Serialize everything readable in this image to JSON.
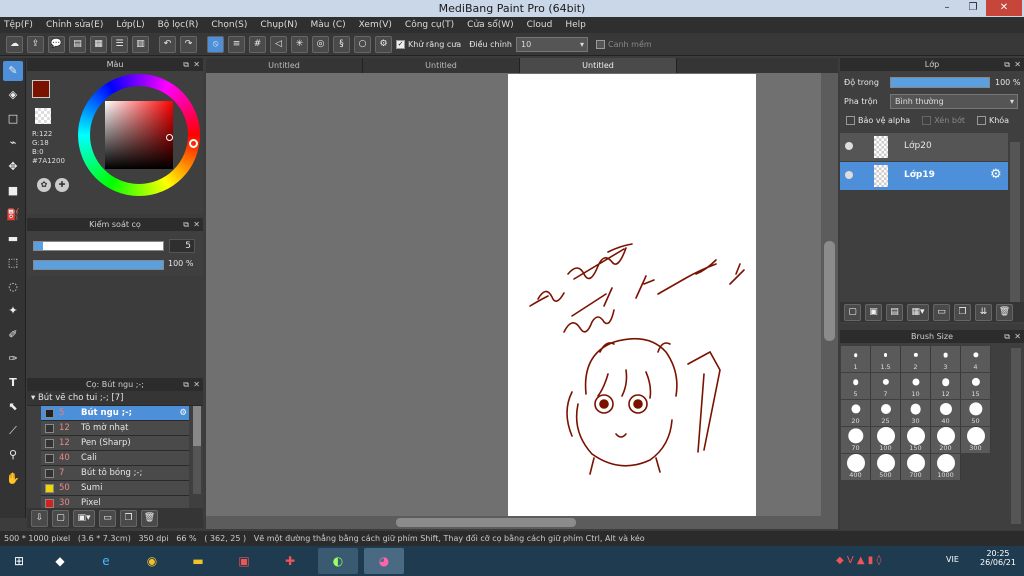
{
  "window": {
    "title": "MediBang Paint Pro (64bit)",
    "minimize": "–",
    "maximize": "❐",
    "close": "✕"
  },
  "menu": [
    "Tệp(F)",
    "Chỉnh sửa(E)",
    "Lớp(L)",
    "Bộ lọc(R)",
    "Chọn(S)",
    "Chụp(N)",
    "Màu (C)",
    "Xem(V)",
    "Công cụ(T)",
    "Cửa sổ(W)",
    "Cloud",
    "Help"
  ],
  "toolbar": {
    "antialias_label": "Khử răng cưa",
    "adjust_label": "Điều chỉnh",
    "adjust_value": "10",
    "smooth_label": "Canh mềm"
  },
  "color_panel": {
    "title": "Màu",
    "r": "R:122",
    "g": "G:18",
    "b": "B:0",
    "hex": "#7A1200",
    "primary_color": "#7a1200"
  },
  "brush_control": {
    "title": "Kiểm soát cọ",
    "size_value": "5",
    "opacity_value": "100 %",
    "opacity_fraction": 1.0
  },
  "brush_panel": {
    "title": "Cọ: Bút ngu ;-;",
    "group": "Bút vẽ cho tui ;-; [7]",
    "items": [
      {
        "size": "5",
        "name": "Bút ngu ;-;",
        "color": "#222222",
        "selected": true
      },
      {
        "size": "12",
        "name": "Tô mờ nhạt",
        "color": "#333333",
        "selected": false
      },
      {
        "size": "12",
        "name": "Pen (Sharp)",
        "color": "#333333",
        "selected": false
      },
      {
        "size": "40",
        "name": "Cali",
        "color": "#333333",
        "selected": false
      },
      {
        "size": "7",
        "name": "Bút tô bóng ;-;",
        "color": "#333333",
        "selected": false
      },
      {
        "size": "50",
        "name": "Sumi",
        "color": "#f2d600",
        "selected": false
      },
      {
        "size": "30",
        "name": "Pixel",
        "color": "#d62020",
        "selected": false
      }
    ]
  },
  "tabs": [
    "Untitled",
    "Untitled",
    "Untitled"
  ],
  "layer_panel": {
    "title": "Lớp",
    "opacity_label": "Độ trong",
    "opacity_value": "100 %",
    "blend_label": "Pha trộn",
    "blend_value": "Bình thường",
    "protect_alpha": "Bảo vệ alpha",
    "clipping": "Xén bớt",
    "lock": "Khóa",
    "layers": [
      {
        "name": "Lớp20",
        "selected": false
      },
      {
        "name": "Lớp19",
        "selected": true
      }
    ]
  },
  "brush_size": {
    "title": "Brush Size",
    "sizes": [
      "1",
      "1.5",
      "2",
      "3",
      "4",
      "5",
      "7",
      "10",
      "12",
      "15",
      "20",
      "25",
      "30",
      "40",
      "50",
      "70",
      "100",
      "150",
      "200",
      "300",
      "400",
      "500",
      "700",
      "1000"
    ]
  },
  "statusbar": {
    "dims": "500 * 1000 pixel",
    "cm": "(3.6 * 7.3cm)",
    "dpi": "350 dpi",
    "zoom": "66 %",
    "coord": "( 362, 25 )",
    "hint": "Vẽ một đường thẳng bằng cách giữ phím Shift, Thay đổi cỡ cọ bằng cách giữ phím Ctrl, Alt và kéo"
  },
  "taskbar": {
    "lang": "VIE",
    "time": "20:25",
    "date": "26/06/21"
  }
}
